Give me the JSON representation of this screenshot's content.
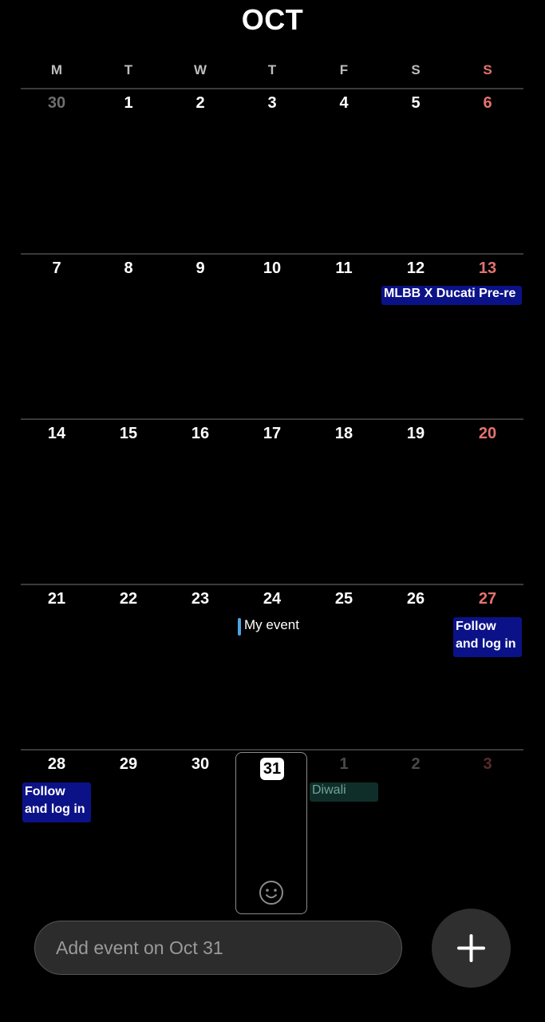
{
  "header": {
    "month": "OCT"
  },
  "weekdays": [
    "M",
    "T",
    "W",
    "T",
    "F",
    "S",
    "S"
  ],
  "weeks": [
    {
      "days": [
        "30",
        "1",
        "2",
        "3",
        "4",
        "5",
        "6"
      ]
    },
    {
      "days": [
        "7",
        "8",
        "9",
        "10",
        "11",
        "12",
        "13"
      ]
    },
    {
      "days": [
        "14",
        "15",
        "16",
        "17",
        "18",
        "19",
        "20"
      ]
    },
    {
      "days": [
        "21",
        "22",
        "23",
        "24",
        "25",
        "26",
        "27"
      ]
    },
    {
      "days": [
        "28",
        "29",
        "30",
        "31",
        "1",
        "2",
        "3"
      ]
    }
  ],
  "events": {
    "mlbb": "MLBB X Ducati Pre-re",
    "my_event": "My event",
    "follow_27": "Follow and log in or",
    "follow_28": "Follow and log in or",
    "diwali": "Diwali"
  },
  "today": {
    "day": "31"
  },
  "add_bar": {
    "placeholder": "Add event on Oct 31"
  },
  "icons": {
    "fab": "plus-icon",
    "today_marker": "smiley-icon"
  },
  "colors": {
    "weekend": "#e5736d",
    "event_bg": "#0b1288",
    "holiday_bg": "#0f2e2a",
    "accent": "#4fa3e0"
  }
}
